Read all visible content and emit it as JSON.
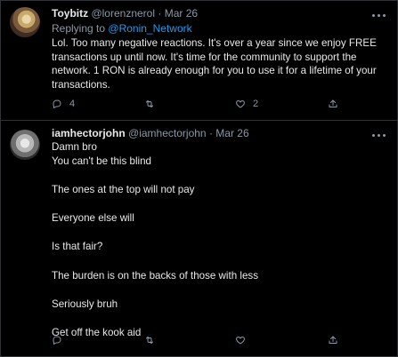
{
  "tweet1": {
    "name": "Toybitz",
    "handle": "@lorenznerol",
    "dot": "·",
    "date": "Mar 26",
    "replying_prefix": "Replying to",
    "replying_to": "@Ronin_Network",
    "text": "Lol. Too many negative reactions. It's over a year since we enjoy FREE transactions up until now. It's time for the community to support the network. 1 RON is already enough for you to use it for a lifetime of your transactions.",
    "reply_count": "4",
    "like_count": "2"
  },
  "tweet2": {
    "name": "iamhectorjohn",
    "handle": "@iamhectorjohn",
    "dot": "·",
    "date": "Mar 26",
    "lines": [
      "Damn bro",
      "You can't be this blind",
      "The ones at the top will not pay",
      "Everyone else will",
      "Is that fair?",
      "The burden is on the backs of those with less",
      "Seriously bruh",
      "Get off the kook aid"
    ]
  },
  "icons": {
    "more": "more-icon",
    "reply": "reply-icon",
    "retweet": "retweet-icon",
    "like": "like-icon",
    "share": "share-icon"
  },
  "colors": {
    "background": "#000000",
    "text": "#e7e9ea",
    "muted": "#8b98a5",
    "link": "#1d9bf0",
    "divider": "#2f3336"
  }
}
